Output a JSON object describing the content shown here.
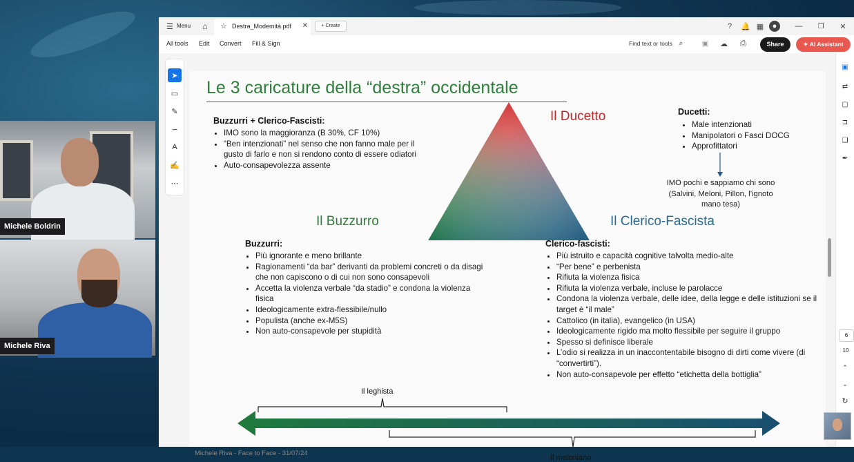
{
  "participants": [
    {
      "name": "Michele Boldrin"
    },
    {
      "name": "Michele Riva"
    }
  ],
  "app": {
    "tabbar": {
      "menu_label": "Menu",
      "tab_title": "Destra_Modemità.pdf",
      "create_label": "Create"
    },
    "toolbar": {
      "items": [
        "All tools",
        "Edit",
        "Convert",
        "Fill & Sign"
      ],
      "find_label": "Find text or tools",
      "share_label": "Share",
      "ai_label": "AI Assistant"
    },
    "page_nav": {
      "current": "6",
      "total": "10"
    }
  },
  "slide": {
    "title": "Le 3 caricature della “destra” occidentale",
    "corners": {
      "top": "Il Ducetto",
      "left": "Il Buzzurro",
      "right": "Il Clerico-Fascista"
    },
    "top_left_box": {
      "header": "Buzzurri + Clerico-Fascisti:",
      "items": [
        "IMO sono la maggioranza (B 30%, CF 10%)",
        "“Ben intenzionati” nel senso che non fanno male per il gusto di farlo e non si rendono conto di essere odiatori",
        "Auto-consapevolezza assente"
      ]
    },
    "ducetti_box": {
      "header": "Ducetti:",
      "items": [
        "Male intenzionati",
        "Manipolatori o Fasci DOCG",
        "Approfittatori"
      ],
      "note": "IMO pochi e sappiamo chi sono (Salvini, Meloni, Pillon, l’ignoto mano tesa)"
    },
    "buzzurri_box": {
      "header": "Buzzurri:",
      "items": [
        "Più ignorante e meno brillante",
        "Ragionamenti “da bar” derivanti da problemi concreti o da disagi che non capiscono o di cui non sono consapevoli",
        "Accetta la violenza verbale “da stadio” e condona la violenza fisica",
        "Ideologicamente extra-flessibile/nullo",
        "Populista (anche ex-M5S)",
        "Non auto-consapevole per stupidità"
      ]
    },
    "clerico_box": {
      "header": "Clerico-fascisti:",
      "items": [
        "Più istruito e capacità cognitive talvolta medio-alte",
        "“Per bene” e perbenista",
        "Rifiuta la violenza fisica",
        "Rifiuta la violenza verbale, incluse le parolacce",
        "Condona la violenza verbale, delle idee, della legge e delle istituzioni se il target è “il male”",
        "Cattolico (in italia), evangelico (in USA)",
        "Ideologicamente rigido ma molto flessibile per seguire il gruppo",
        "Spesso si definisce liberale",
        "L’odio si realizza in un inaccontentabile bisogno di dirti come vivere (di “convertirti”).",
        "Non auto-consapevole per effetto “etichetta della bottiglia”"
      ]
    },
    "spectrum": {
      "upper_label": "Il leghista",
      "lower_label": "Il meloniano"
    },
    "footer": "Michele Riva - Face to Face - 31/07/24"
  },
  "colors": {
    "title_green": "#2e7d3a",
    "corner_red": "#c62828",
    "corner_green": "#2e7d3a",
    "corner_blue": "#2b6a8e",
    "accent_blue": "#1473e6",
    "ai_button": "#e9584f"
  }
}
